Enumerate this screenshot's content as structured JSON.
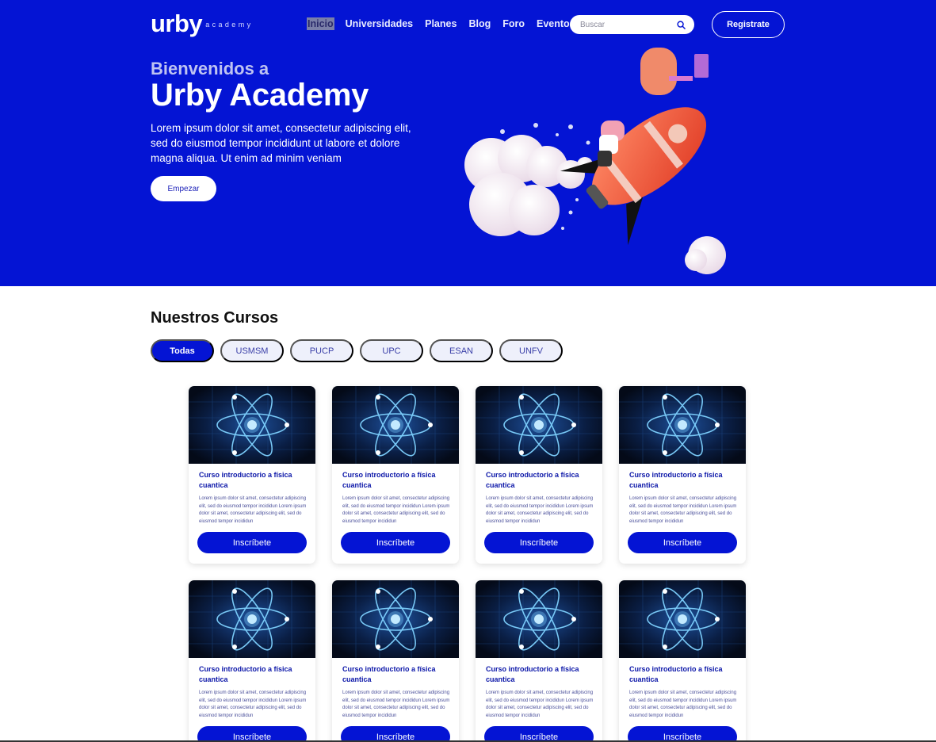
{
  "colors": {
    "brand": "#0414d4",
    "white": "#ffffff",
    "chip_bg": "#eef0fb"
  },
  "header": {
    "logo_word": "urby",
    "logo_sub": "academy",
    "nav": [
      "Inicio",
      "Universidades",
      "Planes",
      "Blog",
      "Foro",
      "Eventos"
    ],
    "active_nav": "Inicio",
    "search_placeholder": "Buscar",
    "search_icon": "search-icon",
    "register_label": "Registrate"
  },
  "hero": {
    "subtitle": "Bienvenidos a",
    "title": "Urby Academy",
    "text": "Lorem ipsum dolor sit amet, consectetur adipiscing elit, sed do eiusmod tempor incididunt ut labore et dolore magna aliqua. Ut enim ad minim veniam",
    "button_label": "Empezar"
  },
  "courses": {
    "title": "Nuestros Cursos",
    "filters": [
      "Todas",
      "USMSM",
      "PUCP",
      "UPC",
      "ESAN",
      "UNFV"
    ],
    "active_filter": "Todas",
    "cards": [
      {
        "title": "Curso introductorio a física cuantica",
        "desc": "Lorem ipsum dolor sit amet, consectetur adipiscing elit, sed do eiusmod tempor incididun Lorem ipsum dolor sit amet, consectetur adipiscing elit, sed do eiusmod tempor incididun",
        "button": "Inscríbete"
      },
      {
        "title": "Curso introductorio a física cuantica",
        "desc": "Lorem ipsum dolor sit amet, consectetur adipiscing elit, sed do eiusmod tempor incididun Lorem ipsum dolor sit amet, consectetur adipiscing elit, sed do eiusmod tempor incididun",
        "button": "Inscríbete"
      },
      {
        "title": "Curso introductorio a física cuantica",
        "desc": "Lorem ipsum dolor sit amet, consectetur adipiscing elit, sed do eiusmod tempor incididun Lorem ipsum dolor sit amet, consectetur adipiscing elit, sed do eiusmod tempor incididun",
        "button": "Inscríbete"
      },
      {
        "title": "Curso introductorio a física cuantica",
        "desc": "Lorem ipsum dolor sit amet, consectetur adipiscing elit, sed do eiusmod tempor incididun Lorem ipsum dolor sit amet, consectetur adipiscing elit, sed do eiusmod tempor incididun",
        "button": "Inscríbete"
      },
      {
        "title": "Curso introductorio a física cuantica",
        "desc": "Lorem ipsum dolor sit amet, consectetur adipiscing elit, sed do eiusmod tempor incididun Lorem ipsum dolor sit amet, consectetur adipiscing elit, sed do eiusmod tempor incididun",
        "button": "Inscríbete"
      },
      {
        "title": "Curso introductorio a física cuantica",
        "desc": "Lorem ipsum dolor sit amet, consectetur adipiscing elit, sed do eiusmod tempor incididun Lorem ipsum dolor sit amet, consectetur adipiscing elit, sed do eiusmod tempor incididun",
        "button": "Inscríbete"
      },
      {
        "title": "Curso introductorio a física cuantica",
        "desc": "Lorem ipsum dolor sit amet, consectetur adipiscing elit, sed do eiusmod tempor incididun Lorem ipsum dolor sit amet, consectetur adipiscing elit, sed do eiusmod tempor incididun",
        "button": "Inscríbete"
      },
      {
        "title": "Curso introductorio a física cuantica",
        "desc": "Lorem ipsum dolor sit amet, consectetur adipiscing elit, sed do eiusmod tempor incididun Lorem ipsum dolor sit amet, consectetur adipiscing elit, sed do eiusmod tempor incididun",
        "button": "Inscríbete"
      }
    ]
  }
}
